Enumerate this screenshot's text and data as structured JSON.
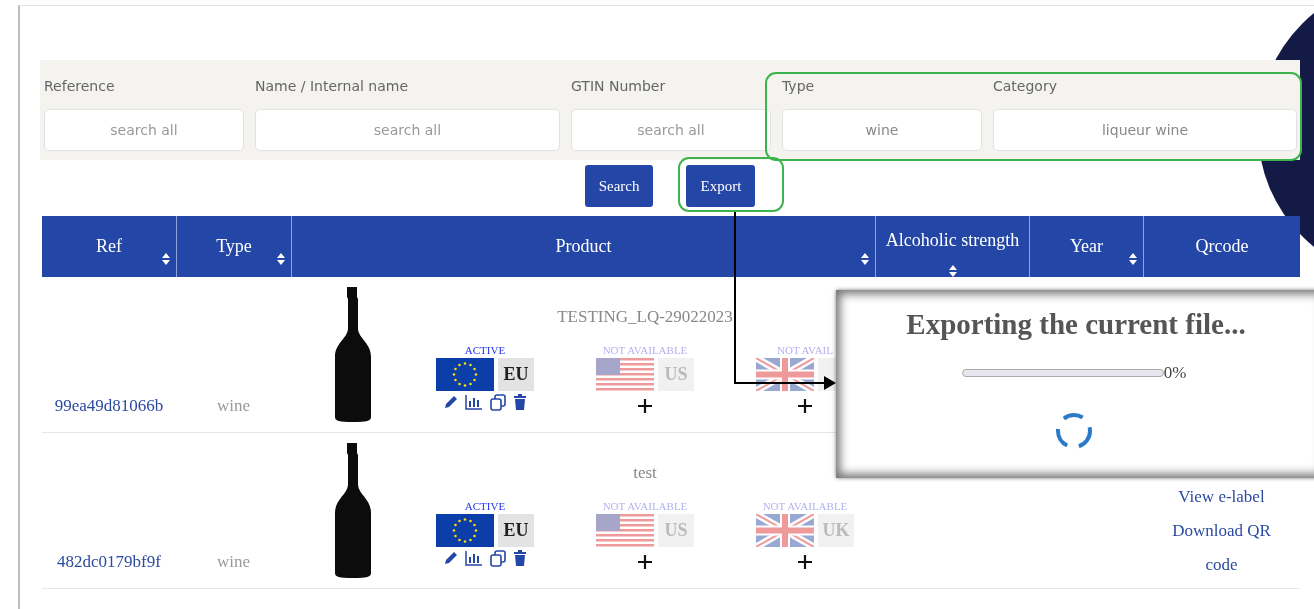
{
  "filters": [
    {
      "label": "Reference",
      "placeholder": "search all"
    },
    {
      "label": "Name / Internal name",
      "placeholder": "search all"
    },
    {
      "label": "GTIN Number",
      "placeholder": "search all"
    },
    {
      "label": "Type",
      "value": "wine"
    },
    {
      "label": "Category",
      "value": "liqueur wine"
    }
  ],
  "buttons": [
    "Search",
    "Export"
  ],
  "table": {
    "columns": [
      {
        "label": "Ref",
        "sortable": true
      },
      {
        "label": "Type",
        "sortable": true
      },
      {
        "label": "Product",
        "sortable": true
      },
      {
        "label": "Alcoholic strength",
        "sortable": true
      },
      {
        "label": "Year",
        "sortable": true
      },
      {
        "label": "Qrcode",
        "sortable": false
      }
    ],
    "rows": [
      {
        "ref": "99ea49d81066b",
        "type": "wine",
        "product": "TESTING_LQ-29022023",
        "markets": [
          {
            "kind": "eu",
            "status": "ACTIVE",
            "active": true,
            "code": "EU"
          },
          {
            "kind": "us",
            "status": "NOT AVAILABLE",
            "active": false,
            "code": "US"
          },
          {
            "kind": "uk",
            "status": "NOT AVAIL",
            "active": false
          }
        ],
        "qrcode": []
      },
      {
        "ref": "482dc0179bf9f",
        "type": "wine",
        "product": "test",
        "markets": [
          {
            "kind": "eu",
            "status": "ACTIVE",
            "active": true,
            "code": "EU"
          },
          {
            "kind": "us",
            "status": "NOT AVAILABLE",
            "active": false,
            "code": "US"
          },
          {
            "kind": "uk",
            "status": "NOT AVAILABLE",
            "active": false,
            "code": "UK"
          }
        ],
        "qrcode": [
          "View e-label",
          "Download QR code"
        ]
      }
    ]
  },
  "dialog": {
    "title": "Exporting the current file...",
    "level": 0,
    "reading": "0%"
  }
}
